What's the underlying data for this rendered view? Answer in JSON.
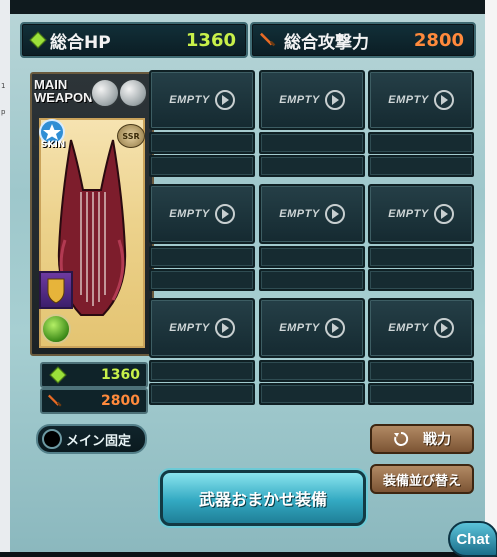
{
  "stats": {
    "total_hp_label": "総合HP",
    "total_hp_value": "1360",
    "total_atk_label": "総合攻撃力",
    "total_atk_value": "2800"
  },
  "main_weapon": {
    "title_line1": "MAIN",
    "title_line2": "WEAPON",
    "skin_label": "SKIN",
    "rarity": "SSR",
    "hp": "1360",
    "atk": "2800"
  },
  "slots": {
    "empty_label": "EMPTY"
  },
  "buttons": {
    "main_lock": "メイン固定",
    "power": "戦力",
    "sort": "装備並び替え",
    "auto_equip": "武器おまかせ装備",
    "chat": "Chat"
  },
  "colors": {
    "hp_value": "#c8f04a",
    "atk_value": "#ff8a3c",
    "accent_teal": "#33a9c2"
  },
  "left_strip_ticks": [
    "1",
    "p"
  ]
}
